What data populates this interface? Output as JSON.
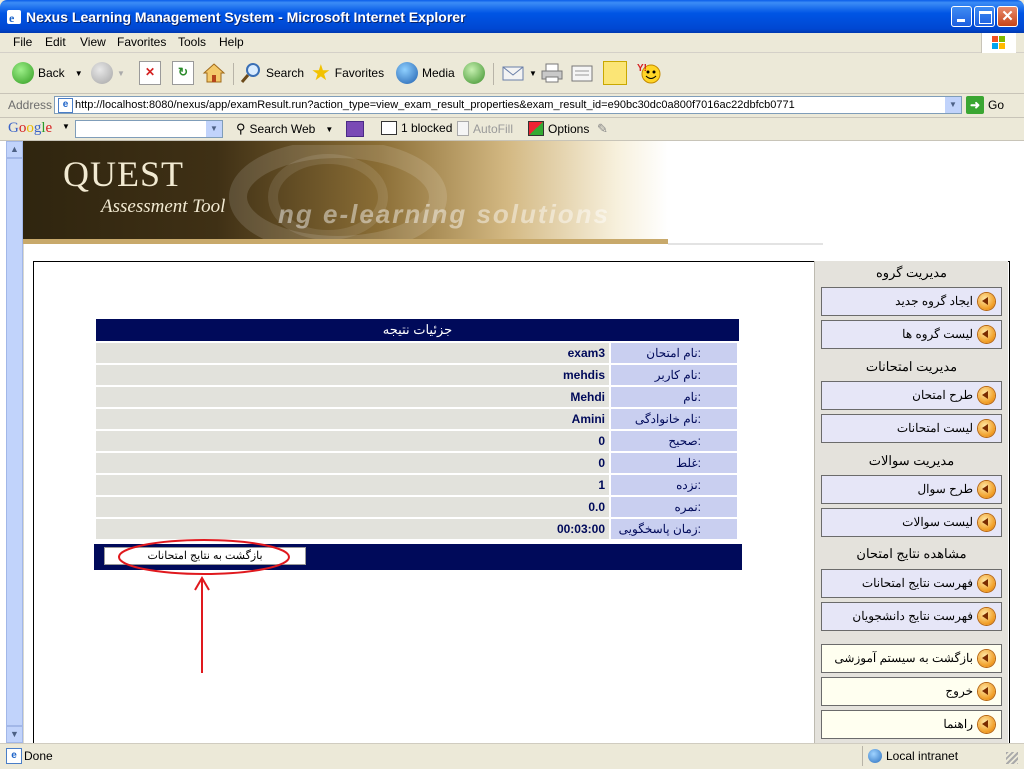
{
  "window": {
    "title": "Nexus Learning Management System - Microsoft Internet Explorer"
  },
  "menu": [
    "File",
    "Edit",
    "View",
    "Favorites",
    "Tools",
    "Help"
  ],
  "toolbar": {
    "back": "Back",
    "search": "Search",
    "favorites": "Favorites",
    "media": "Media"
  },
  "address": {
    "label": "Address",
    "url": "http://localhost:8080/nexus/app/examResult.run?action_type=view_exam_result_properties&exam_result_id=e90bc30dc0a800f7016ac22dbfcb0771",
    "go": "Go"
  },
  "googlebar": {
    "logo": "Google",
    "search_web": "Search Web",
    "blocked": "1 blocked",
    "autofill": "AutoFill",
    "options": "Options"
  },
  "banner": {
    "quest": "QUEST",
    "assessment": "Assessment Tool",
    "tagline": "ng e-learning solutions"
  },
  "result": {
    "title": "جزئیات نتیجه",
    "rows": [
      {
        "label": "نام امتحان:",
        "value": "exam3"
      },
      {
        "label": "نام کاربر:",
        "value": "mehdis"
      },
      {
        "label": "نام:",
        "value": "Mehdi"
      },
      {
        "label": "نام خانوادگی:",
        "value": "Amini"
      },
      {
        "label": "صحیح:",
        "value": "0"
      },
      {
        "label": "غلط:",
        "value": "0"
      },
      {
        "label": "نزده:",
        "value": "1"
      },
      {
        "label": "نمره:",
        "value": "0.0"
      },
      {
        "label": "زمان پاسخگویی:",
        "value": "00:03:00"
      }
    ],
    "back_button": "بازگشت به نتایج امتحانات"
  },
  "sidebar": {
    "sections": [
      {
        "title": "مدیریت گروه",
        "items": [
          "ایجاد گروه جدید",
          "لیست گروه ها"
        ]
      },
      {
        "title": "مدیریت امتحانات",
        "items": [
          "طرح امتحان",
          "لیست امتحانات"
        ]
      },
      {
        "title": "مدیریت سوالات",
        "items": [
          "طرح سوال",
          "لیست سوالات"
        ]
      },
      {
        "title": "مشاهده نتایج امتحان",
        "items": [
          "فهرست نتایج امتحانات",
          "فهرست نتایج دانشجویان"
        ]
      }
    ],
    "footer_items": [
      "بازگشت به سیستم آموزشی",
      "خروج",
      "راهنما"
    ]
  },
  "status": {
    "text": "Done",
    "zone": "Local intranet"
  },
  "colors": {
    "navy": "#000a5a",
    "annotation": "#e0191e"
  }
}
